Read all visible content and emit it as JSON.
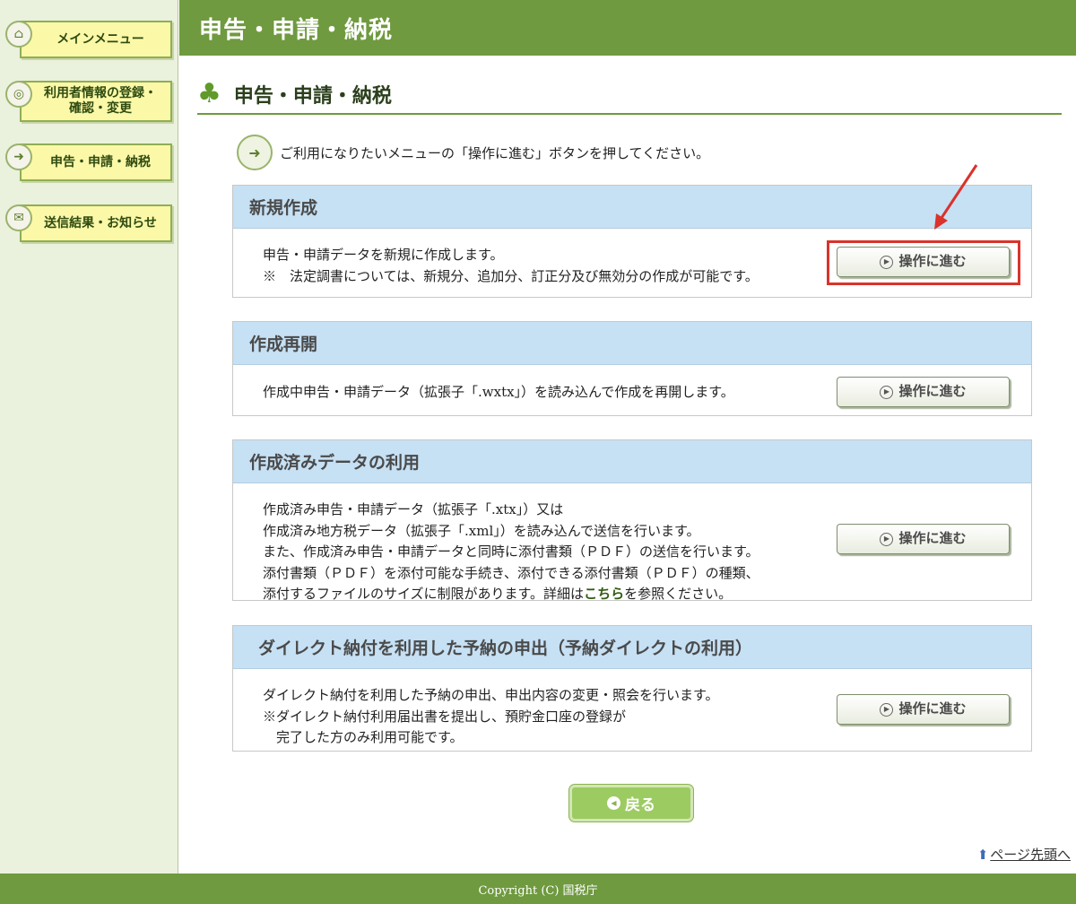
{
  "header": {
    "title": "申告・申請・納税"
  },
  "sidebar": {
    "items": [
      {
        "line1": "メインメニュー",
        "line2": ""
      },
      {
        "line1": "利用者情報の登録・",
        "line2": "確認・変更"
      },
      {
        "line1": "申告・申請・納税",
        "line2": ""
      },
      {
        "line1": "送信結果・お知らせ",
        "line2": ""
      }
    ]
  },
  "page": {
    "title": "申告・申請・納税",
    "instruction": "ご利用になりたいメニューの「操作に進む」ボタンを押してください。"
  },
  "proceed_label": "操作に進む",
  "sections": [
    {
      "title": "新規作成",
      "lines": [
        "申告・申請データを新規に作成します。",
        "※　法定調書については、新規分、追加分、訂正分及び無効分の作成が可能です。"
      ]
    },
    {
      "title": "作成再開",
      "lines": [
        "作成中申告・申請データ（拡張子「.wxtx」）を読み込んで作成を再開します。"
      ]
    },
    {
      "title": "作成済みデータの利用",
      "lines": [
        "作成済み申告・申請データ（拡張子「.xtx」）又は",
        "作成済み地方税データ（拡張子「.xml」）を読み込んで送信を行います。",
        "また、作成済み申告・申請データと同時に添付書類（ＰＤＦ）の送信を行います。",
        "添付書類（ＰＤＦ）を添付可能な手続き、添付できる添付書類（ＰＤＦ）の種類、"
      ],
      "last_line_prefix": "添付するファイルのサイズに制限があります。詳細は",
      "last_line_link": "こちら",
      "last_line_suffix": "を参照ください。"
    },
    {
      "title": "ダイレクト納付を利用した予納の申出（予納ダイレクトの利用）",
      "lines": [
        "ダイレクト納付を利用した予納の申出、申出内容の変更・照会を行います。",
        "※ダイレクト納付利用届出書を提出し、預貯金口座の登録が",
        "　完了した方のみ利用可能です。"
      ]
    }
  ],
  "back_label": "戻る",
  "page_top_label": "ページ先頭へ",
  "footer": {
    "copyright": "Copyright (C) 国税庁"
  },
  "colors": {
    "brand_green": "#6f9a3f",
    "section_header_blue": "#c6e0f4",
    "sidebar_button_yellow": "#fbf8a8",
    "highlight_red": "#d9332b"
  },
  "icons": [
    "home-icon",
    "user-settings-icon",
    "document-arrow-icon",
    "envelope-icon",
    "clover-icon",
    "play-icon",
    "back-icon",
    "page-top-arrow-icon"
  ]
}
